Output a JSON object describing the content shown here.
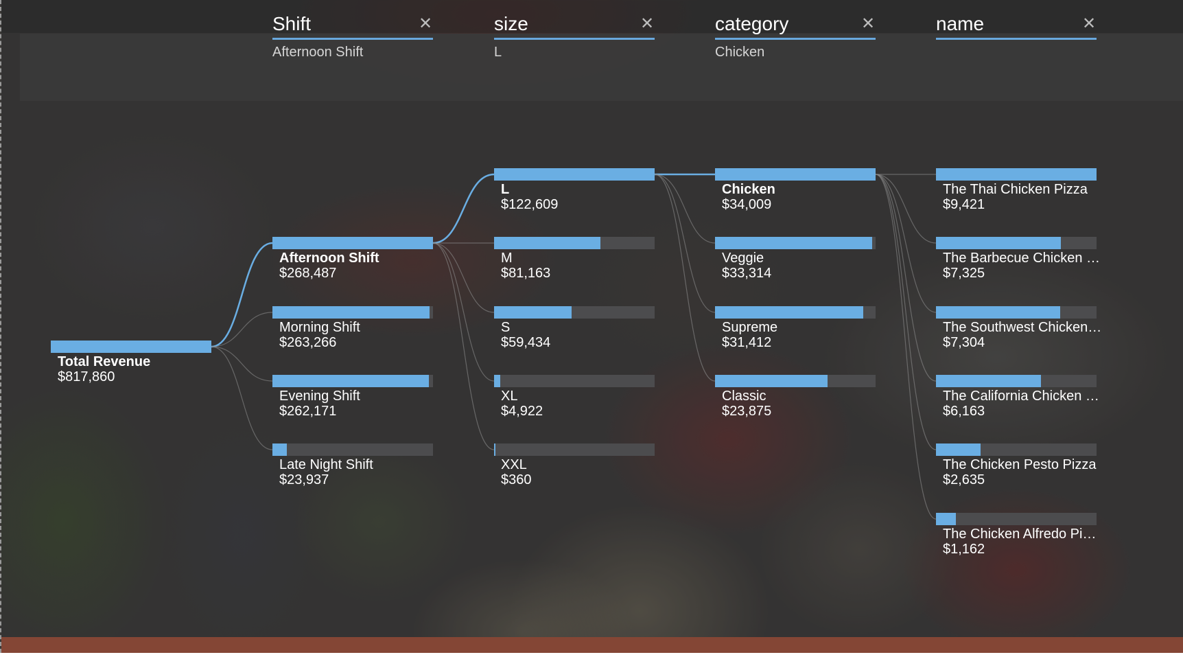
{
  "header_filters": [
    {
      "field": "Shift",
      "selected": "Afternoon Shift"
    },
    {
      "field": "size",
      "selected": "L"
    },
    {
      "field": "category",
      "selected": "Chicken"
    },
    {
      "field": "name",
      "selected": ""
    }
  ],
  "close_icon": "close-icon",
  "colors": {
    "bar_fill": "#6aaee3",
    "bar_track": "#4c4c4e",
    "header_underline": "#69a8dd",
    "active_link": "#6aaee3",
    "inactive_link": "#8a8a8a",
    "text": "#ffffff"
  },
  "root": {
    "label": "Total Revenue",
    "value": "$817,860",
    "amount": 817860
  },
  "levels": [
    {
      "field": "Shift",
      "max": 268487,
      "nodes": [
        {
          "label": "Afternoon Shift",
          "value": "$268,487",
          "amount": 268487,
          "selected": true
        },
        {
          "label": "Morning Shift",
          "value": "$263,266",
          "amount": 263266,
          "selected": false
        },
        {
          "label": "Evening Shift",
          "value": "$262,171",
          "amount": 262171,
          "selected": false
        },
        {
          "label": "Late Night Shift",
          "value": "$23,937",
          "amount": 23937,
          "selected": false
        }
      ]
    },
    {
      "field": "size",
      "max": 122609,
      "nodes": [
        {
          "label": "L",
          "value": "$122,609",
          "amount": 122609,
          "selected": true
        },
        {
          "label": "M",
          "value": "$81,163",
          "amount": 81163,
          "selected": false
        },
        {
          "label": "S",
          "value": "$59,434",
          "amount": 59434,
          "selected": false
        },
        {
          "label": "XL",
          "value": "$4,922",
          "amount": 4922,
          "selected": false
        },
        {
          "label": "XXL",
          "value": "$360",
          "amount": 360,
          "selected": false
        }
      ]
    },
    {
      "field": "category",
      "max": 34009,
      "nodes": [
        {
          "label": "Chicken",
          "value": "$34,009",
          "amount": 34009,
          "selected": true
        },
        {
          "label": "Veggie",
          "value": "$33,314",
          "amount": 33314,
          "selected": false
        },
        {
          "label": "Supreme",
          "value": "$31,412",
          "amount": 31412,
          "selected": false
        },
        {
          "label": "Classic",
          "value": "$23,875",
          "amount": 23875,
          "selected": false
        }
      ]
    },
    {
      "field": "name",
      "max": 9421,
      "nodes": [
        {
          "label": "The Thai Chicken Pizza",
          "value": "$9,421",
          "amount": 9421,
          "selected": false
        },
        {
          "label": "The Barbecue Chicken Pizza",
          "value": "$7,325",
          "amount": 7325,
          "selected": false
        },
        {
          "label": "The Southwest Chicken Pizza",
          "value": "$7,304",
          "amount": 7304,
          "selected": false
        },
        {
          "label": "The California Chicken Pizza",
          "value": "$6,163",
          "amount": 6163,
          "selected": false
        },
        {
          "label": "The Chicken Pesto Pizza",
          "value": "$2,635",
          "amount": 2635,
          "selected": false
        },
        {
          "label": "The Chicken Alfredo Pizza",
          "value": "$1,162",
          "amount": 1162,
          "selected": false
        }
      ]
    }
  ]
}
